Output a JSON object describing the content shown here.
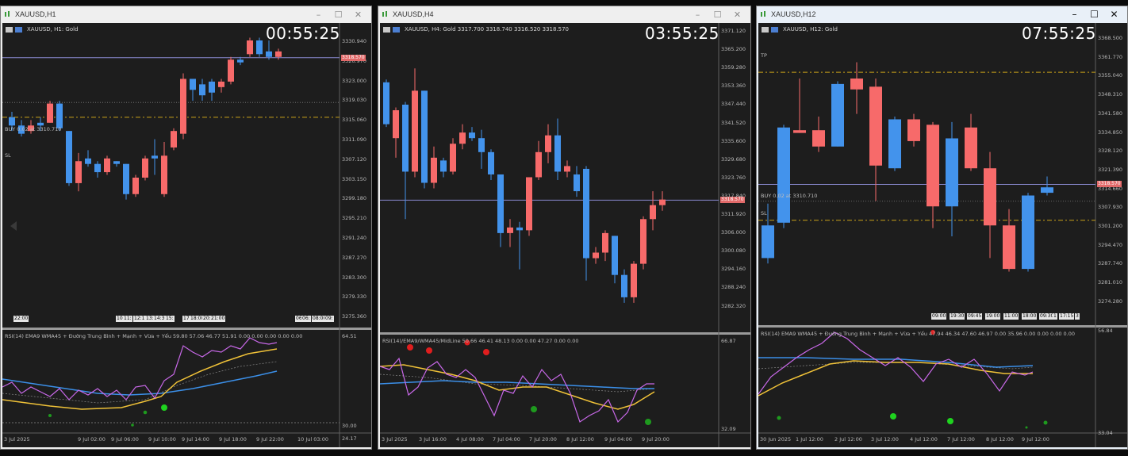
{
  "theme": {
    "bull": "#4393ec",
    "bear": "#f76a6a",
    "bg": "#1d1d1d",
    "dashed": "#c9a21a",
    "rsi": "#c868e8",
    "ema": "#f0c238",
    "wma": "#3b8fe8",
    "dot_green": "#1fd31f",
    "dot_red": "#e01e1e",
    "price_line": "#8a8ad0"
  },
  "windows": [
    {
      "title": "XAUUSD,H1",
      "header": "XAUUSD, H1:  Gold",
      "timer": "00:55:25",
      "price_tag": "3318.570",
      "buy_label": "BUY 0.02 at 3310.710",
      "sl_label": "SL",
      "tp_label": "",
      "indicator_label": "RSI(14) EMA9 WMA45 + Đường Trung Bình + Mạnh + Vừa + Yếu 59.80 57.06 46.77 51.91 0.00 0.00 0.00 0.00 0.00",
      "price_axis": [
        "3330.940",
        "3326.970",
        "3323.000",
        "3319.030",
        "3315.060",
        "3311.090",
        "3307.120",
        "3303.150",
        "3299.180",
        "3295.210",
        "3291.240",
        "3287.270",
        "3283.300",
        "3279.330",
        "3275.360"
      ],
      "ind_axis": [
        "64.51",
        "30.00",
        "24.17"
      ],
      "time_axis": [
        "3 Jul 2025",
        "9 Jul 02:00",
        "9 Jul 06:00",
        "9 Jul 10:00",
        "9 Jul 14:00",
        "9 Jul 18:00",
        "9 Jul 22:00",
        "10 Jul 03:00"
      ],
      "bottom_tabs": [
        "22:00",
        "10:",
        "11:",
        "12:15",
        "13:",
        "14:30",
        "15:",
        "17:",
        "18:00",
        "20:",
        "21:00",
        "06:",
        "06:",
        "08:00",
        "09:"
      ]
    },
    {
      "title": "XAUUSD,H4",
      "header": "XAUUSD, H4:  Gold  3317.700 3318.740 3316.520 3318.570",
      "timer": "03:55:25",
      "price_tag": "3318.570",
      "buy_label": "",
      "sl_label": "",
      "tp_label": "",
      "indicator_label": "RSI(14)/EMA9/WMA45/MidLine 50.66 46.41 48.13 0.00 0.00 47.27 0.00 0.00",
      "price_axis": [
        "3371.120",
        "3365.200",
        "3359.280",
        "3353.360",
        "3347.440",
        "3341.520",
        "3335.600",
        "3329.680",
        "3323.760",
        "3317.840",
        "3311.920",
        "3306.000",
        "3300.080",
        "3294.160",
        "3288.240",
        "3282.320"
      ],
      "ind_axis": [
        "66.87",
        "32.09"
      ],
      "time_axis": [
        "3 Jul 2025",
        "3 Jul 16:00",
        "4 Jul 08:00",
        "7 Jul 04:00",
        "7 Jul 20:00",
        "8 Jul 12:00",
        "9 Jul 04:00",
        "9 Jul 20:00"
      ],
      "bottom_tabs": []
    },
    {
      "title": "XAUUSD,H12",
      "header": "XAUUSD, H12:  Gold",
      "timer": "07:55:25",
      "price_tag": "3318.570",
      "buy_label": "BUY 0.02 at 3310.710",
      "sl_label": "SL",
      "tp_label": "TP",
      "indicator_label": "RSI(14) EMA9 WMA45 + Đường Trung Bình + Mạnh + Vừa + Yếu 47.94 46.34 47.60 46.97 0.00 35.96 0.00 0.00 0.00 0.00",
      "price_axis": [
        "3368.500",
        "3361.770",
        "3355.040",
        "3348.310",
        "3341.580",
        "3334.850",
        "3328.120",
        "3321.390",
        "3314.660",
        "3307.930",
        "3301.200",
        "3294.470",
        "3287.740",
        "3281.010",
        "3274.280"
      ],
      "ind_axis": [
        "56.84",
        "33.04"
      ],
      "time_axis": [
        "30 Jun 2025",
        "1 Jul 12:00",
        "2 Jul 12:00",
        "3 Jul 12:00",
        "4 Jul 12:00",
        "7 Jul 12:00",
        "8 Jul 12:00",
        "9 Jul 12:00"
      ],
      "bottom_tabs": [
        "09:00",
        "19:30",
        "09:45",
        "19:00",
        "11:00",
        "18:00",
        "09:30",
        "1",
        "17:15",
        "3"
      ]
    }
  ]
}
